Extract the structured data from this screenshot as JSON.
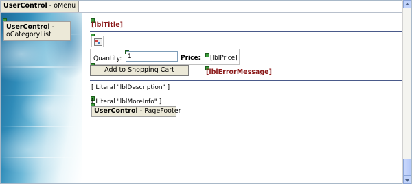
{
  "menu_control": {
    "type_label": "UserControl",
    "separator": " - ",
    "name": "oMenu"
  },
  "category_control": {
    "type_label": "UserControl",
    "separator": " - ",
    "name": "oCategoryList"
  },
  "labels": {
    "title": "[lblTitle]",
    "quantity": "Quantity:",
    "quantity_value": "1",
    "price": "Price:",
    "price_value": "[lblPrice]",
    "add_button": "Add to Shopping Cart",
    "error_message": "[lblErrorMessage]",
    "literal_description": "[ Literal \"lblDescription\" ]",
    "literal_more_info": "[ Literal \"lblMoreInfo\" ]"
  },
  "footer_control": {
    "type_label": "UserControl",
    "separator": " - ",
    "name": "PageFooter"
  },
  "colors": {
    "label_red": "#8b1a1a",
    "control_bg": "#ece9d8",
    "rule_blue": "#4a5a8a"
  },
  "icons": [
    "designer-glyph-icon",
    "broken-image-icon",
    "scroll-up-arrow-icon",
    "scroll-down-arrow-icon"
  ]
}
